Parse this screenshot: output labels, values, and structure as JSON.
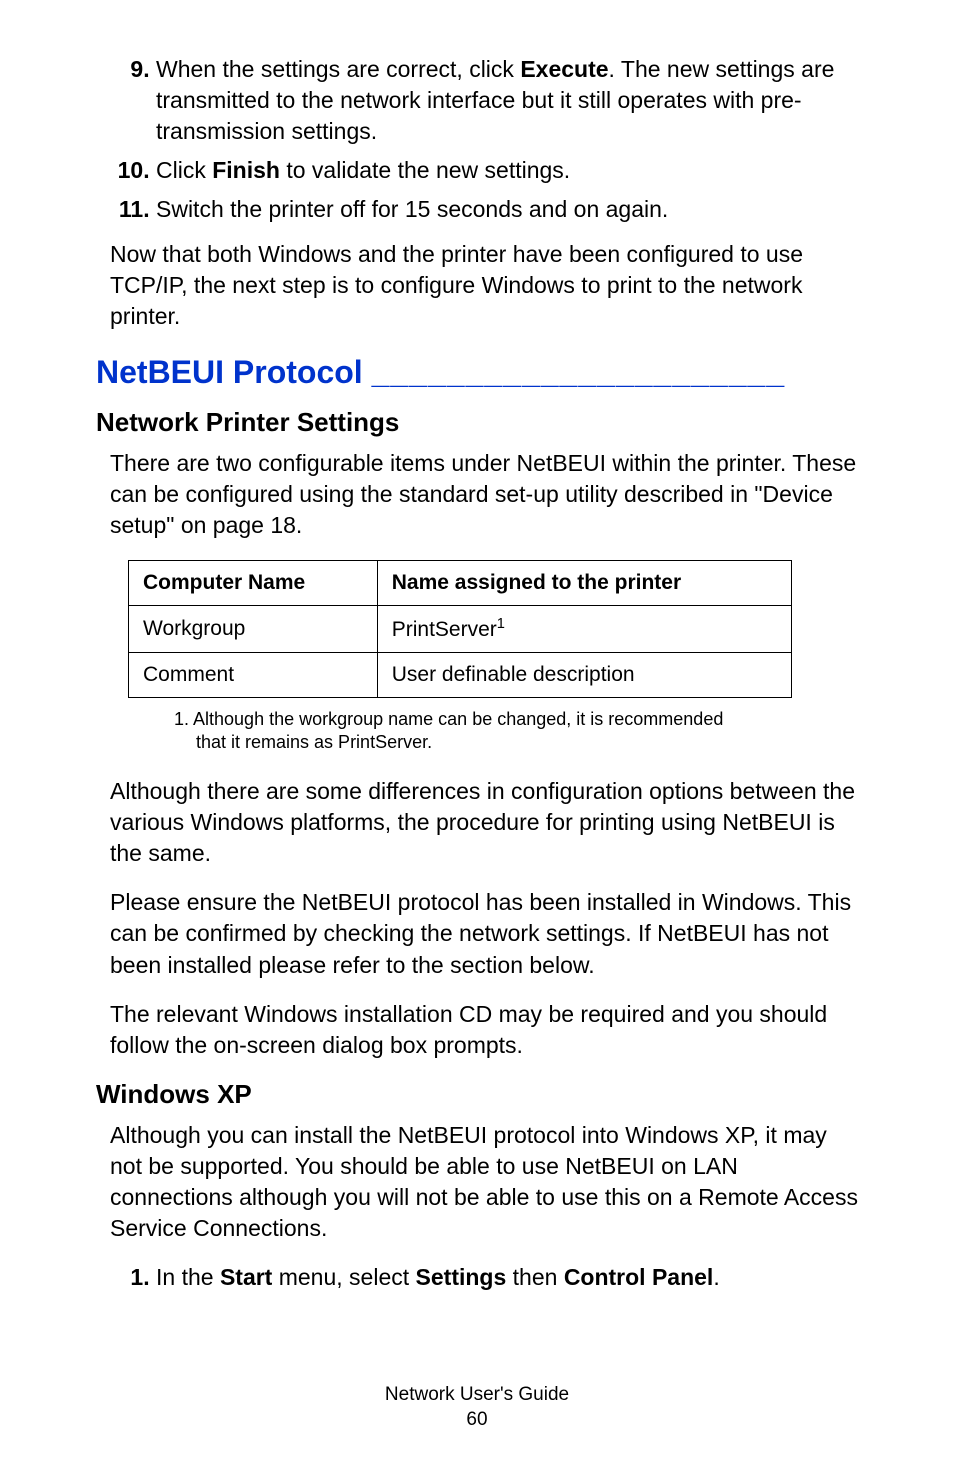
{
  "steps": {
    "item9_num": "9.",
    "item9_pre": "When the settings are correct, click ",
    "item9_bold": "Execute",
    "item9_post": ". The new settings are transmitted to the network interface but it still operates with pre-transmission settings.",
    "item10_num": "10.",
    "item10_pre": "Click ",
    "item10_bold": "Finish",
    "item10_post": " to validate the new settings.",
    "item11_num": "11.",
    "item11_text": "Switch the printer off for 15 seconds and on again."
  },
  "para_after_steps": "Now that both Windows and the printer have been configured to use TCP/IP, the next step is to configure Windows to print to the network printer.",
  "section_title": "NetBEUI Protocol ",
  "section_rule": "______________________",
  "nps": {
    "heading": "Network Printer Settings",
    "para": "There are two configurable items under NetBEUI within the printer. These can be configured using the standard set-up utility described in \"Device setup\" on page 18."
  },
  "table": {
    "h1": "Computer Name",
    "h2": "Name assigned to the printer",
    "r1c1": "Workgroup",
    "r1c2_base": "PrintServer",
    "r1c2_sup": "1",
    "r2c1": "Comment",
    "r2c2": "User definable description"
  },
  "footnote": "1.  Although the workgroup name can be changed, it is recommended that it remains as PrintServer.",
  "para_diff": "Although there are some differences in configuration options between the various Windows platforms, the procedure for printing using NetBEUI is the same.",
  "para_ensure": "Please ensure the NetBEUI protocol has been installed in Windows. This can be confirmed by checking the network settings. If NetBEUI has not been installed please refer to the section below.",
  "para_cd": "The relevant Windows installation CD may be required and you should follow the on-screen dialog box prompts.",
  "winxp": {
    "heading": "Windows XP",
    "para": "Although you can install the NetBEUI protocol into Windows XP, it may not be supported. You should be able to use NetBEUI on LAN connections although you will not be able to use this on a Remote Access Service Connections.",
    "step1_pre": "In the ",
    "step1_b1": "Start",
    "step1_mid1": " menu, select ",
    "step1_b2": "Settings",
    "step1_mid2": " then ",
    "step1_b3": "Control Panel",
    "step1_post": "."
  },
  "footer": {
    "line1": "Network User's Guide",
    "line2": "60"
  }
}
